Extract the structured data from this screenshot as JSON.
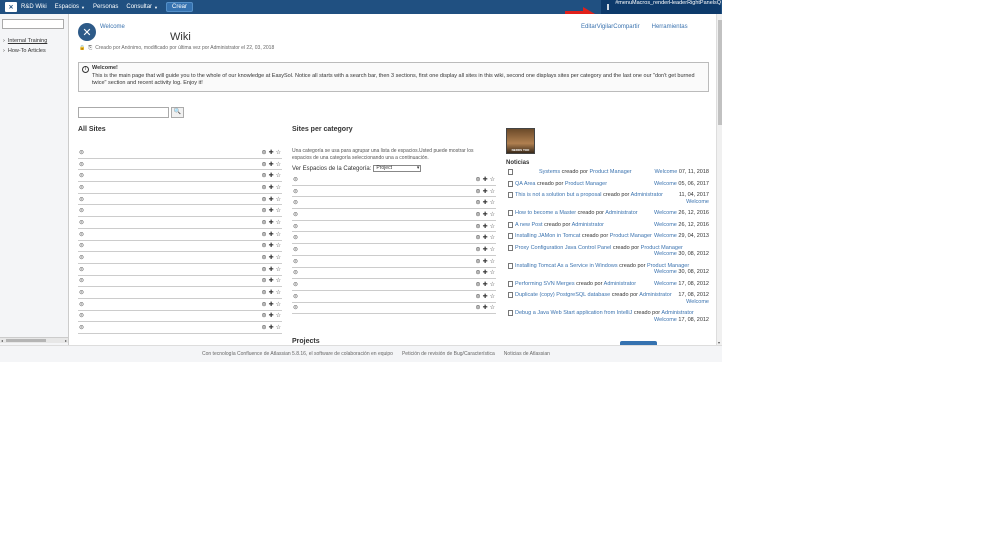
{
  "topbar": {
    "brand": "R&D Wiki",
    "nav": [
      {
        "label": "Espacios",
        "caret": true
      },
      {
        "label": "Personas",
        "caret": false
      },
      {
        "label": "Consultar",
        "caret": true
      }
    ],
    "create_label": "Crear",
    "right_panel_text": "#menuMacros_renderHeaderRightPanelsQ"
  },
  "sidebar": {
    "tree": [
      {
        "label": "Internal Training",
        "current": true
      },
      {
        "label": "How-To Articles",
        "current": false
      }
    ]
  },
  "page": {
    "breadcrumb": "Welcome",
    "title": "Wiki",
    "actions": {
      "edit": "Editar",
      "watch": "Vigilar",
      "share": "Compartir",
      "tools": "Herramientas"
    },
    "meta": "Creado por Anónimo, modificado por última vez por Administrator el 22, 03, 2018",
    "info": {
      "heading": "Welcome!",
      "body": "This is the main page that will guide you to the whole of our knowledge at EasySol. Notice all starts with a search bar, then 3 sections, first one display all sites in this wiki, second one displays sites per category and the last one our \"don't get burned twice\" section and recent activity log. Enjoy it!"
    },
    "all_sites_title": "All Sites",
    "sites_per_category_title": "Sites per category",
    "category_description": "Una categoría se usa para agrupar una lista de espacios.Usted puede mostrar los espacios de una categoría seleccionando una a continuación.",
    "category_select_label": "Ver Espacios de la Categoría:",
    "category_selected": "Project",
    "avatar_caption": "NERDS TOO",
    "news_title": "Noticias",
    "projects_title": "Projects"
  },
  "news_items": [
    {
      "title": "Systems",
      "creado": "creado por",
      "author": "Product Manager",
      "space": "Welcome",
      "date": "07, 11, 2018",
      "wrap": false
    },
    {
      "title": "QA Area",
      "creado": "creado por",
      "author": "Product Manager",
      "space": "Welcome",
      "date": "05, 06, 2017",
      "wrap": false
    },
    {
      "title": "This is not a solution but a proposal",
      "creado": "creado por",
      "author": "Administrator",
      "space": "Welcome",
      "date": "11, 04, 2017",
      "wrap": "date-first"
    },
    {
      "title": "How to become a Master",
      "creado": "creado por",
      "author": "Administrator",
      "space": "Welcome",
      "date": "26, 12, 2016",
      "wrap": false
    },
    {
      "title": "A new Post",
      "creado": "creado por",
      "author": "Administrator",
      "space": "Welcome",
      "date": "26, 12, 2016",
      "wrap": false
    },
    {
      "title": "Installing JAMon in Tomcat",
      "creado": "creado por",
      "author": "Product Manager",
      "space": "Welcome",
      "date": "29, 04, 2013",
      "wrap": false
    },
    {
      "title": "Proxy Configuration Java Control Panel",
      "creado": "creado por",
      "author": "Product Manager",
      "space": "Welcome",
      "date": "30, 08, 2012",
      "wrap": true
    },
    {
      "title": "Installing Tomcat As a Service in Windows",
      "creado": "creado por",
      "author": "Product Manager",
      "space": "Welcome",
      "date": "30, 08, 2012",
      "wrap": true
    },
    {
      "title": "Performing SVN Merges",
      "creado": "creado por",
      "author": "Administrator",
      "space": "Welcome",
      "date": "17, 08, 2012",
      "wrap": false
    },
    {
      "title": "Duplicate (copy) PostgreSQL database",
      "creado": "creado por",
      "author": "Administrator",
      "space": "Welcome",
      "date": "17, 08, 2012",
      "wrap": "date-first"
    },
    {
      "title": "Debug a Java Web Start application from IntelliJ",
      "creado": "creado por",
      "author": "Administrator",
      "space": "Welcome",
      "date": "17, 08, 2012",
      "wrap": true
    }
  ],
  "footer": {
    "powered": "Con tecnología Confluence de Atlassian 5.8.16, el software de colaboración en equipo",
    "report": "Petición de revisión de Bug/Característica",
    "news": "Noticias de Atlassian"
  },
  "colors": {
    "header": "#205081",
    "link": "#3b73af",
    "arrow": "#e0201b"
  },
  "icons": {
    "logo": "confluence-logo-icon",
    "space": "space-logo-icon",
    "search": "search-icon",
    "globe": "globe-icon",
    "star": "star-icon",
    "plus": "plus-icon",
    "document": "document-icon",
    "arrow": "red-arrow-icon"
  }
}
